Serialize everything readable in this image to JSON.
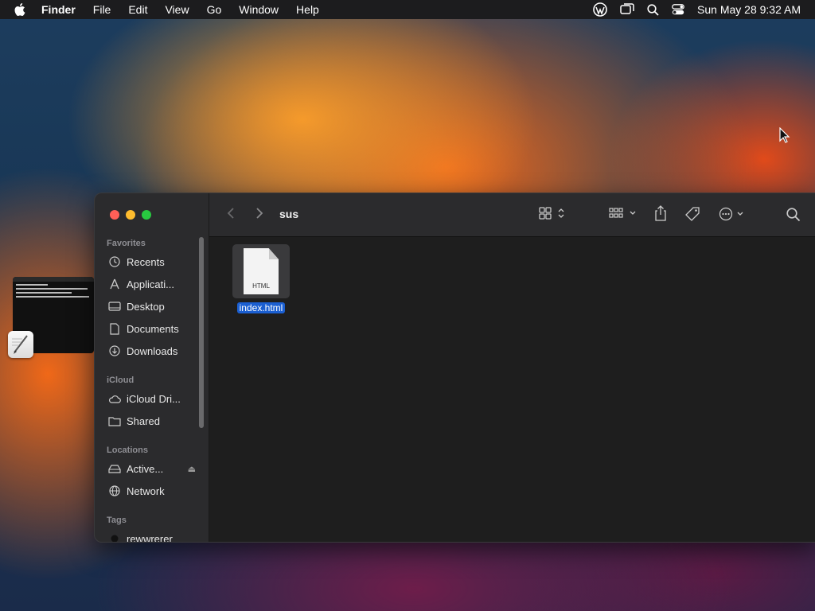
{
  "menubar": {
    "app": "Finder",
    "items": [
      "File",
      "Edit",
      "View",
      "Go",
      "Window",
      "Help"
    ],
    "clock": "Sun May 28  9:32 AM"
  },
  "finder": {
    "title": "sus",
    "sidebar": {
      "favorites_header": "Favorites",
      "favorites": [
        "Recents",
        "Applicati...",
        "Desktop",
        "Documents",
        "Downloads"
      ],
      "icloud_header": "iCloud",
      "icloud": [
        "iCloud Dri...",
        "Shared"
      ],
      "locations_header": "Locations",
      "locations": [
        "Active...",
        "Network"
      ],
      "tags_header": "Tags",
      "tags": [
        "rewwrerer"
      ]
    },
    "file": {
      "name": "index.html",
      "ext": "HTML"
    }
  },
  "colors": {
    "selection": "#1b5fd1",
    "close": "#ff5f57",
    "minimize": "#febc2e",
    "zoom": "#28c840"
  }
}
